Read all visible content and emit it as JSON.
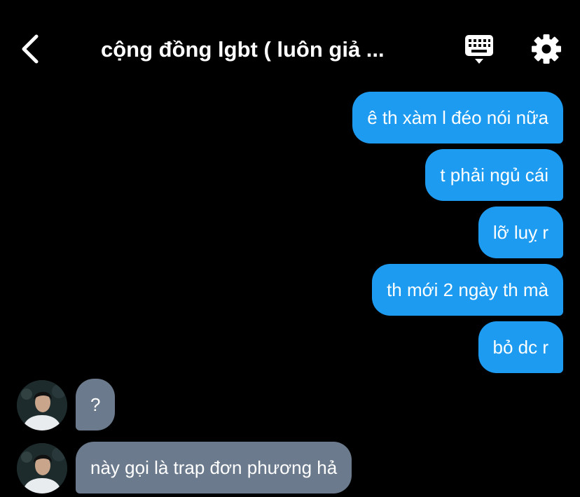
{
  "header": {
    "title": "cộng đồng lgbt ( luôn giả ...",
    "back_icon": "chevron-left-icon",
    "keyboard_icon": "keyboard-icon",
    "settings_icon": "gear-icon"
  },
  "messages": [
    {
      "direction": "sent",
      "text": "ê th xàm l đéo nói nữa"
    },
    {
      "direction": "sent",
      "text": "t phải ngủ cái"
    },
    {
      "direction": "sent",
      "text": "lỡ luỵ r"
    },
    {
      "direction": "sent",
      "text": "th mới 2 ngày th mà"
    },
    {
      "direction": "sent",
      "text": "bỏ dc r"
    },
    {
      "direction": "received",
      "text": "?"
    },
    {
      "direction": "received",
      "text": "này gọi là trap đơn phương hả"
    }
  ],
  "colors": {
    "background": "#000000",
    "sent_bubble": "#1d9bf0",
    "received_bubble": "#6b7a8c",
    "text": "#ffffff"
  }
}
